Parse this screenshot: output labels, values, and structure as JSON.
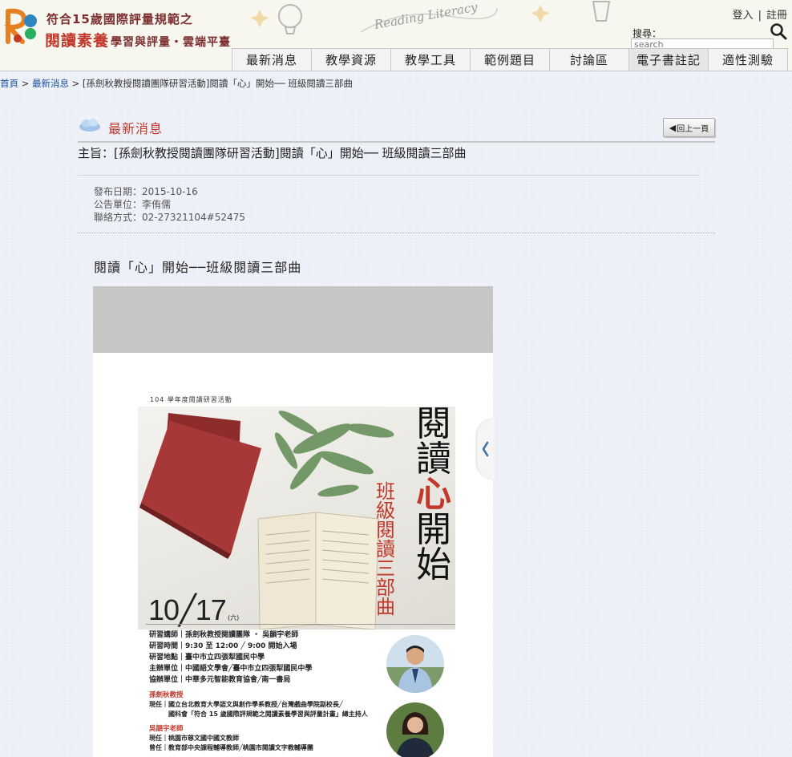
{
  "site": {
    "logo_line1": "符合15歲國際評量規範之",
    "logo_line2_big": "閱讀素養",
    "logo_line2_small": "學習與評量・雲端平臺",
    "deco_text": "Reading Literacy"
  },
  "auth": {
    "login": "登入",
    "register": "註冊"
  },
  "search": {
    "label": "搜尋：",
    "placeholder": "search"
  },
  "nav": [
    {
      "label": "最新消息"
    },
    {
      "label": "教學資源"
    },
    {
      "label": "教學工具"
    },
    {
      "label": "範例題目"
    },
    {
      "label": "討論區"
    },
    {
      "label": "電子書註記"
    },
    {
      "label": "適性測驗"
    }
  ],
  "breadcrumb": {
    "home": "首頁",
    "section": "最新消息",
    "separator": ">",
    "current": "[孫劍秋教授閱讀團隊研習活動]閱讀「心」開始── 班級閱讀三部曲"
  },
  "section": {
    "title": "最新消息",
    "back_button": "回上一頁"
  },
  "news": {
    "subject": "主旨：[孫劍秋教授閱讀團隊研習活動]閱讀「心」開始── 班級閱讀三部曲",
    "date_line": "發布日期：2015-10-16",
    "unit_line": "公告單位：李侑儒",
    "contact_line": "聯絡方式：02-27321104#52475",
    "article_title": "閱讀「心」開始──班級閱讀三部曲"
  },
  "poster": {
    "caption": "104 學年度閱讀研習活動",
    "title_chars": [
      "閱",
      "讀",
      "心",
      "開",
      "始"
    ],
    "subtitle_chars": [
      "班",
      "級",
      "閱",
      "讀",
      "三",
      "部",
      "曲"
    ],
    "date": "10╱17",
    "weekday": "(六)",
    "info": [
      "研習講師｜孫劍秋教授閱讀團隊 ・ 吳韻宇老師",
      "研習時間｜9:30 至 12:00 ╱ 9:00 開始入場",
      "研習地點｜臺中市立四張犁國民中學",
      "主辦單位｜中國語文學會╱臺中市立四張犁國民中學",
      "協辦單位｜中華多元智能教育協會╱南一書局"
    ],
    "person1_name": "孫劍秋教授",
    "person1_lines": [
      "現任｜國立台北教育大學語文與創作學系教授╱台灣戲曲學院副校長╱",
      "　　　國科會「符合 15 歲國際評規範之閱讀素養學習與評量計畫」總主持人"
    ],
    "person2_name": "吳韻宇老師",
    "person2_lines": [
      "現任｜桃園市慈文國中國文教師",
      "曾任｜教育部中央課程輔導教師╱桃園市閱讀文字教輔導團"
    ]
  },
  "colors": {
    "accent_red": "#c0392b",
    "link_blue": "#1a4f9c",
    "logo_brown": "#7b2f2f"
  }
}
